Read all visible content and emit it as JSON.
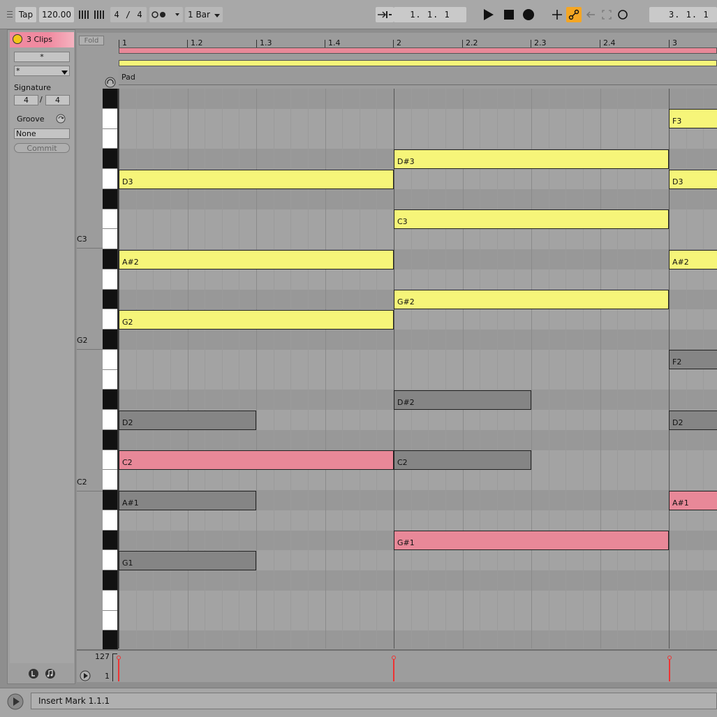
{
  "transport": {
    "tap_label": "Tap",
    "tempo": "120.00",
    "time_sig": "4  /  4",
    "quantize": "1 Bar",
    "arrangement_position": "1.   1.   1",
    "loop_position": "3.   1.   1"
  },
  "clip_panel": {
    "title": "3 Clips",
    "name_field": "*",
    "color_select": "*",
    "signature_label": "Signature",
    "sig_numerator": "4",
    "sig_slash": "/",
    "sig_denominator": "4",
    "groove_label": "Groove",
    "groove_value": "None",
    "commit_label": "Commit"
  },
  "editor": {
    "fold_label": "Fold",
    "track_name": "Pad",
    "ruler_labels": [
      "1",
      "1.2",
      "1.3",
      "1.4",
      "2",
      "2.2",
      "2.3",
      "2.4",
      "3"
    ],
    "octave_labels": [
      "C3",
      "G2",
      "C2"
    ],
    "notes": [
      {
        "pitch": "F3",
        "color": "#f6f579"
      },
      {
        "pitch": "D#3",
        "color": "#f6f579"
      },
      {
        "pitch": "D3",
        "color": "#f6f579"
      },
      {
        "pitch": "D3",
        "color": "#f6f579"
      },
      {
        "pitch": "C3",
        "color": "#f6f579"
      },
      {
        "pitch": "A#2",
        "color": "#f6f579"
      },
      {
        "pitch": "A#2",
        "color": "#f6f579"
      },
      {
        "pitch": "G#2",
        "color": "#f6f579"
      },
      {
        "pitch": "G2",
        "color": "#f6f579"
      },
      {
        "pitch": "F2",
        "color": "#858585"
      },
      {
        "pitch": "D#2",
        "color": "#858585"
      },
      {
        "pitch": "D2",
        "color": "#858585"
      },
      {
        "pitch": "D2",
        "color": "#858585"
      },
      {
        "pitch": "C2",
        "color": "#e88898"
      },
      {
        "pitch": "C2",
        "color": "#858585"
      },
      {
        "pitch": "A#1",
        "color": "#858585"
      },
      {
        "pitch": "A#1",
        "color": "#e88898"
      },
      {
        "pitch": "G#1",
        "color": "#e88898"
      },
      {
        "pitch": "G1",
        "color": "#858585"
      }
    ]
  },
  "velocity": {
    "max_label": "127",
    "min_label": "1"
  },
  "status_bar": {
    "message": "Insert Mark 1.1.1"
  },
  "colors": {
    "accent_orange": "#f5a623",
    "clip_pink": "#e88898",
    "clip_yellow": "#f6f579",
    "velocity_red": "#e33333"
  }
}
